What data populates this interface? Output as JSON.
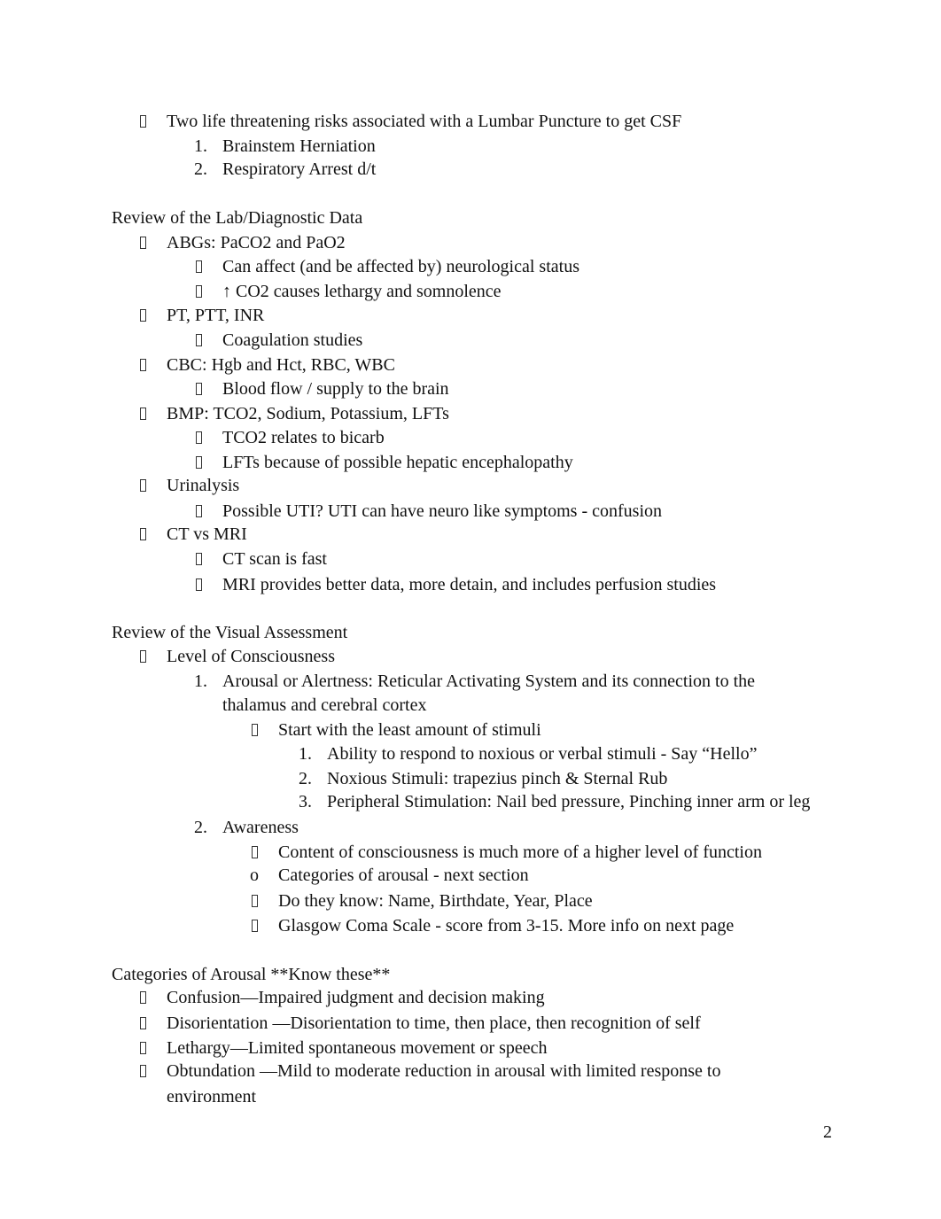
{
  "page_number": "2",
  "lp_section": {
    "bullet": "Two life threatening risks associated with a Lumbar Puncture to get CSF",
    "items": [
      "Brainstem Herniation",
      "Respiratory Arrest d/t"
    ]
  },
  "lab_section": {
    "heading": "Review of the Lab/Diagnostic Data",
    "items": [
      {
        "label": "ABGs: PaCO2 and PaO2",
        "subs": [
          "Can affect (and be affected by) neurological status",
          "↑ CO2 causes lethargy and somnolence"
        ]
      },
      {
        "label": "PT, PTT, INR",
        "subs": [
          "Coagulation studies"
        ]
      },
      {
        "label": "CBC: Hgb and Hct, RBC, WBC",
        "subs": [
          "Blood flow / supply to the brain"
        ]
      },
      {
        "label": "BMP: TCO2, Sodium, Potassium, LFTs",
        "subs": [
          "TCO2 relates to bicarb",
          "LFTs because of possible hepatic encephalopathy"
        ]
      },
      {
        "label": "Urinalysis",
        "subs": [
          "Possible UTI? UTI can have neuro like symptoms - confusion"
        ]
      },
      {
        "label": "CT vs MRI",
        "subs": [
          "CT scan is fast",
          "MRI provides better data, more detain, and includes perfusion studies"
        ]
      }
    ]
  },
  "visual_section": {
    "heading": "Review of the Visual Assessment",
    "loc": "Level of Consciousness",
    "arousal": {
      "num": "1.",
      "line1": "Arousal or Alertness: Reticular Activating System and its connection to the",
      "line2": "thalamus and cerebral cortex",
      "sub": "Start with the least amount of stimuli",
      "steps": [
        {
          "num": "1.",
          "text": "Ability to respond to noxious or verbal stimuli - Say “Hello”"
        },
        {
          "num": "2.",
          "text": "Noxious Stimuli: trapezius pinch & Sternal Rub"
        },
        {
          "num": "3.",
          "text": "Peripheral Stimulation: Nail bed pressure, Pinching inner arm or leg"
        }
      ]
    },
    "awareness": {
      "num": "2.",
      "label": "Awareness",
      "subs": [
        {
          "marker": "box",
          "text": "Content of consciousness is much more of a higher level of function"
        },
        {
          "marker": "o",
          "text": "Categories of arousal - next section"
        },
        {
          "marker": "box",
          "text": "Do they know: Name, Birthdate, Year, Place"
        },
        {
          "marker": "box",
          "text": "Glasgow Coma Scale - score from 3-15. More info on next page"
        }
      ]
    }
  },
  "arousal_section": {
    "heading": "Categories of Arousal **Know these**",
    "items": [
      {
        "term": "Confusion",
        "def": "—Impaired judgment and decision making"
      },
      {
        "term": "Disorientation",
        "def": " —Disorientation to time, then place, then recognition of self"
      },
      {
        "term": "Lethargy",
        "def": "—Limited spontaneous movement or speech"
      },
      {
        "term": "Obtundation",
        "def": " —Mild to moderate reduction in arousal with limited response to",
        "cont": "environment"
      }
    ]
  }
}
